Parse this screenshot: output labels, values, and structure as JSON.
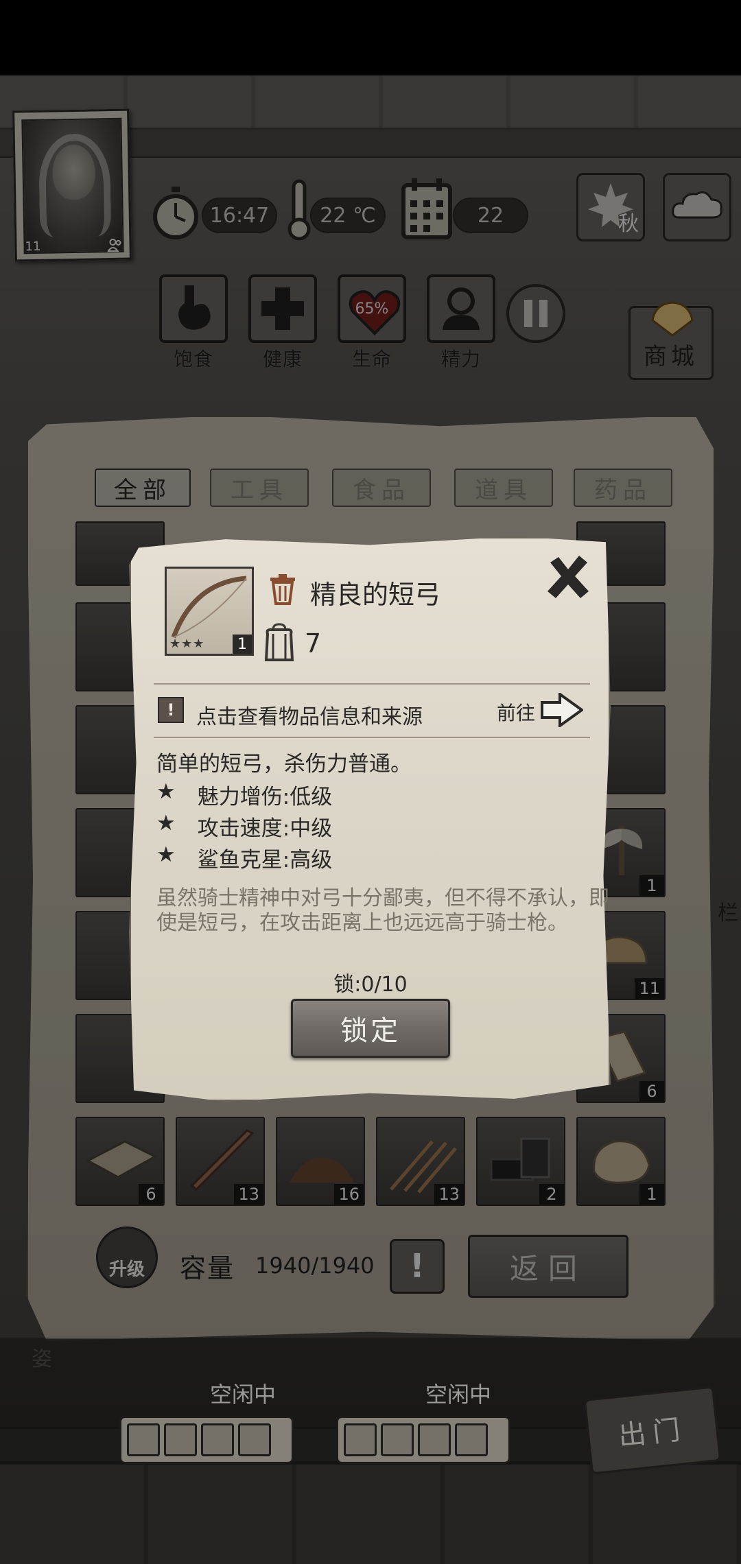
{
  "hud": {
    "time": "16:47",
    "temperature": "22 ℃",
    "day": "22",
    "season": "秋"
  },
  "portrait": {
    "level": "11"
  },
  "stats": [
    {
      "label": "饱食"
    },
    {
      "label": "健康"
    },
    {
      "label": "生命",
      "value": "65%"
    },
    {
      "label": "精力"
    }
  ],
  "shop": {
    "label": "商城"
  },
  "tabs": [
    "全部",
    "工具",
    "食品",
    "道具",
    "药品"
  ],
  "inventory": {
    "visible_counts": [
      "1",
      "11",
      "6"
    ],
    "bottom_row": [
      {
        "item": "plank-board",
        "count": "6"
      },
      {
        "item": "stake",
        "count": "13"
      },
      {
        "item": "dirt-pile",
        "count": "16"
      },
      {
        "item": "arrows",
        "count": "13"
      },
      {
        "item": "scrap-metal",
        "count": "2"
      },
      {
        "item": "stone",
        "count": "1"
      }
    ],
    "capacity_label": "容量",
    "capacity_value": "1940/1940",
    "upgrade_label": "升级",
    "warn_label": "!",
    "return_label": "返回",
    "side_hint": "栏"
  },
  "dialog": {
    "item_name": "精良的短弓",
    "item_quantity": "7",
    "item_quality": "1",
    "item_stars": "★★★",
    "info_text": "点击查看物品信息和来源",
    "goto_label": "前往",
    "description": "简单的短弓，杀伤力普通。",
    "attributes": [
      "魅力增伤:低级",
      "攻击速度:中级",
      "鲨鱼克星:高级"
    ],
    "flavor": "虽然骑士精神中对弓十分鄙夷，但不得不承认，即使是短弓，在攻击距离上也远远高于骑士枪。",
    "lock_count": "锁:0/10",
    "lock_button": "锁定"
  },
  "workers": [
    {
      "status": "空闲中"
    },
    {
      "status": "空闲中"
    }
  ],
  "go_out": "出门",
  "worker_label": "姿"
}
